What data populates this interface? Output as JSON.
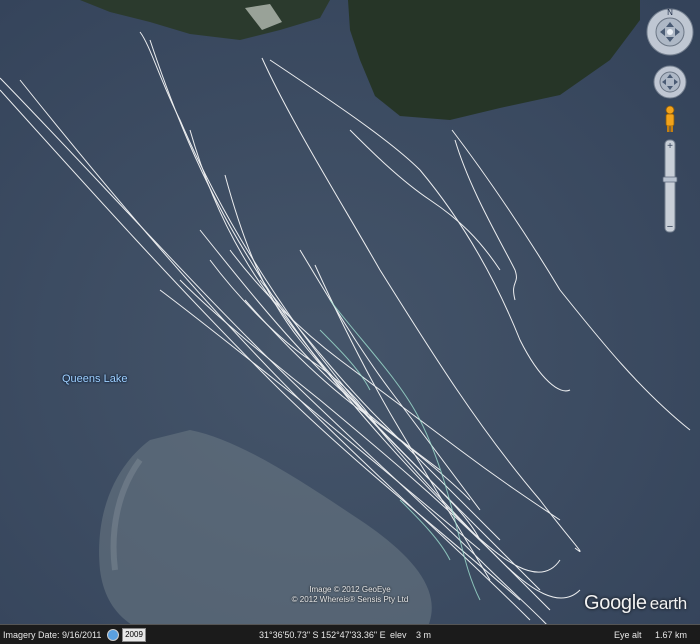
{
  "map": {
    "place_label": "Queens Lake",
    "attribution_line1": "Image © 2012 GeoEye",
    "attribution_line2": "© 2012 Whereis® Sensis Pty Ltd",
    "logo_word1": "Google",
    "logo_word2": "earth",
    "compass_north": "N",
    "colors": {
      "water": "#3b4a5e",
      "land": "#2b3a2d",
      "track": "#ffffff",
      "track_alt": "#9fe0d0",
      "label": "#9fd0ff"
    }
  },
  "controls": {
    "icons": [
      "compass-ring-icon",
      "look-joystick-icon",
      "move-joystick-icon",
      "street-view-pegman-icon",
      "zoom-in-icon",
      "zoom-out-icon"
    ]
  },
  "statusbar": {
    "imagery_label": "Imagery Date:",
    "imagery_date": "9/16/2011",
    "year": "2009",
    "coords": "31°36'50.73\" S  152°47'33.36\" E",
    "elev_label": "elev",
    "elev_value": "3 m",
    "eye_alt_label": "Eye alt",
    "eye_alt_value": "1.67 km"
  }
}
